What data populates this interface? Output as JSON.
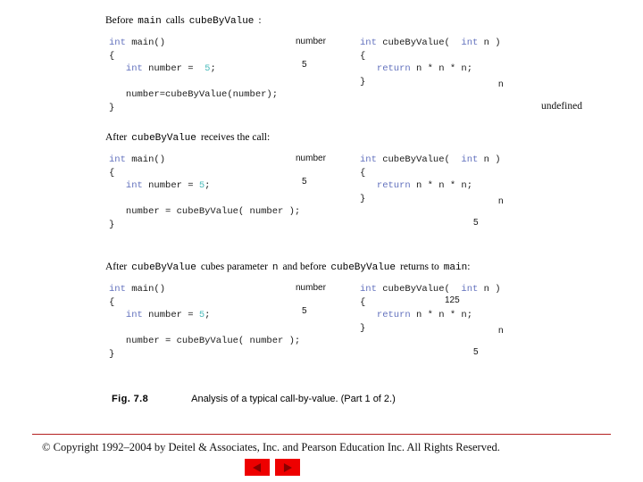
{
  "slide": {
    "caption": {
      "fig_number": "Fig. 7.8",
      "text": "Analysis of a typical call-by-value. (Part 1 of 2.)"
    },
    "copyright": "© Copyright 1992–2004 by Deitel & Associates, Inc. and Pearson Education Inc. All Rights Reserved.",
    "nav": {
      "prev_label": "previous-slide",
      "next_label": "next-slide"
    }
  },
  "sections": [
    {
      "id": "section-1",
      "header": {
        "part1": "Before",
        "code1": "main",
        "part2": "calls",
        "code2": "cubeByValue",
        "part3": ":"
      },
      "left_code": [
        [
          {
            "t": "int",
            "c": "kw"
          },
          {
            "t": " main()",
            "c": "plain"
          }
        ],
        [
          {
            "t": "{",
            "c": "plain"
          }
        ],
        [
          {
            "t": "   ",
            "c": "plain"
          },
          {
            "t": "int",
            "c": "kw"
          },
          {
            "t": " number = ",
            "c": "plain"
          },
          {
            "t": " 5",
            "c": "lit"
          },
          {
            "t": ";",
            "c": "plain"
          }
        ],
        [],
        [
          {
            "t": "   number=cubeByValue(number);",
            "c": "plain"
          }
        ],
        [
          {
            "t": "}",
            "c": "plain"
          }
        ]
      ],
      "right_code": [
        [
          {
            "t": "int",
            "c": "kw"
          },
          {
            "t": " cubeByValue(  ",
            "c": "plain"
          },
          {
            "t": "int",
            "c": "kw"
          },
          {
            "t": " n )",
            "c": "plain"
          }
        ],
        [
          {
            "t": "{",
            "c": "plain"
          }
        ],
        [
          {
            "t": "   ",
            "c": "plain"
          },
          {
            "t": "return",
            "c": "kw"
          },
          {
            "t": " n * n * n;",
            "c": "plain"
          }
        ],
        [
          {
            "t": "}",
            "c": "plain"
          }
        ]
      ],
      "annotations": {
        "number_label": "number",
        "number_value": "5",
        "n_label": "n",
        "n_value": "undefined",
        "result": ""
      }
    },
    {
      "id": "section-2",
      "header": {
        "part1": "After",
        "code1": "cubeByValue",
        "part2": "receives the call:",
        "code2": "",
        "part3": ""
      },
      "left_code": [
        [
          {
            "t": "int",
            "c": "kw"
          },
          {
            "t": " main()",
            "c": "plain"
          }
        ],
        [
          {
            "t": "{",
            "c": "plain"
          }
        ],
        [
          {
            "t": "   ",
            "c": "plain"
          },
          {
            "t": "int",
            "c": "kw"
          },
          {
            "t": " number = ",
            "c": "plain"
          },
          {
            "t": "5",
            "c": "lit"
          },
          {
            "t": ";",
            "c": "plain"
          }
        ],
        [],
        [
          {
            "t": "   number = cubeByValue( number );",
            "c": "plain"
          }
        ],
        [
          {
            "t": "}",
            "c": "plain"
          }
        ]
      ],
      "right_code": [
        [
          {
            "t": "int",
            "c": "kw"
          },
          {
            "t": " cubeByValue(  ",
            "c": "plain"
          },
          {
            "t": "int",
            "c": "kw"
          },
          {
            "t": " n )",
            "c": "plain"
          }
        ],
        [
          {
            "t": "{",
            "c": "plain"
          }
        ],
        [
          {
            "t": "   ",
            "c": "plain"
          },
          {
            "t": "return",
            "c": "kw"
          },
          {
            "t": " n * n * n;",
            "c": "plain"
          }
        ],
        [
          {
            "t": "}",
            "c": "plain"
          }
        ]
      ],
      "annotations": {
        "number_label": "number",
        "number_value": "5",
        "n_label": "n",
        "n_value": "5",
        "result": ""
      }
    },
    {
      "id": "section-3",
      "header": {
        "part1": "After",
        "code1": "cubeByValue",
        "part2": "cubes parameter",
        "code2": "n",
        "part3": "and before",
        "code3": "cubeByValue",
        "part4": "returns to",
        "code4": "main",
        "part5": ":"
      },
      "left_code": [
        [
          {
            "t": "int",
            "c": "kw"
          },
          {
            "t": " main()",
            "c": "plain"
          }
        ],
        [
          {
            "t": "{",
            "c": "plain"
          }
        ],
        [
          {
            "t": "   ",
            "c": "plain"
          },
          {
            "t": "int",
            "c": "kw"
          },
          {
            "t": " number = ",
            "c": "plain"
          },
          {
            "t": "5",
            "c": "lit"
          },
          {
            "t": ";",
            "c": "plain"
          }
        ],
        [],
        [
          {
            "t": "   number = cubeByValue( number );",
            "c": "plain"
          }
        ],
        [
          {
            "t": "}",
            "c": "plain"
          }
        ]
      ],
      "right_code": [
        [
          {
            "t": "int",
            "c": "kw"
          },
          {
            "t": " cubeByValue(  ",
            "c": "plain"
          },
          {
            "t": "int",
            "c": "kw"
          },
          {
            "t": " n )",
            "c": "plain"
          }
        ],
        [
          {
            "t": "{",
            "c": "plain"
          }
        ],
        [
          {
            "t": "   ",
            "c": "plain"
          },
          {
            "t": "return",
            "c": "kw"
          },
          {
            "t": " n * n * n;",
            "c": "plain"
          }
        ],
        [
          {
            "t": "}",
            "c": "plain"
          }
        ]
      ],
      "annotations": {
        "number_label": "number",
        "number_value": "5",
        "n_label": "n",
        "n_value": "5",
        "result": "125"
      }
    }
  ],
  "colors": {
    "keyword": "#6170bd",
    "literal": "#4cbcbc",
    "nav_button": "#ee0000",
    "footer_rule": "#b42020"
  }
}
